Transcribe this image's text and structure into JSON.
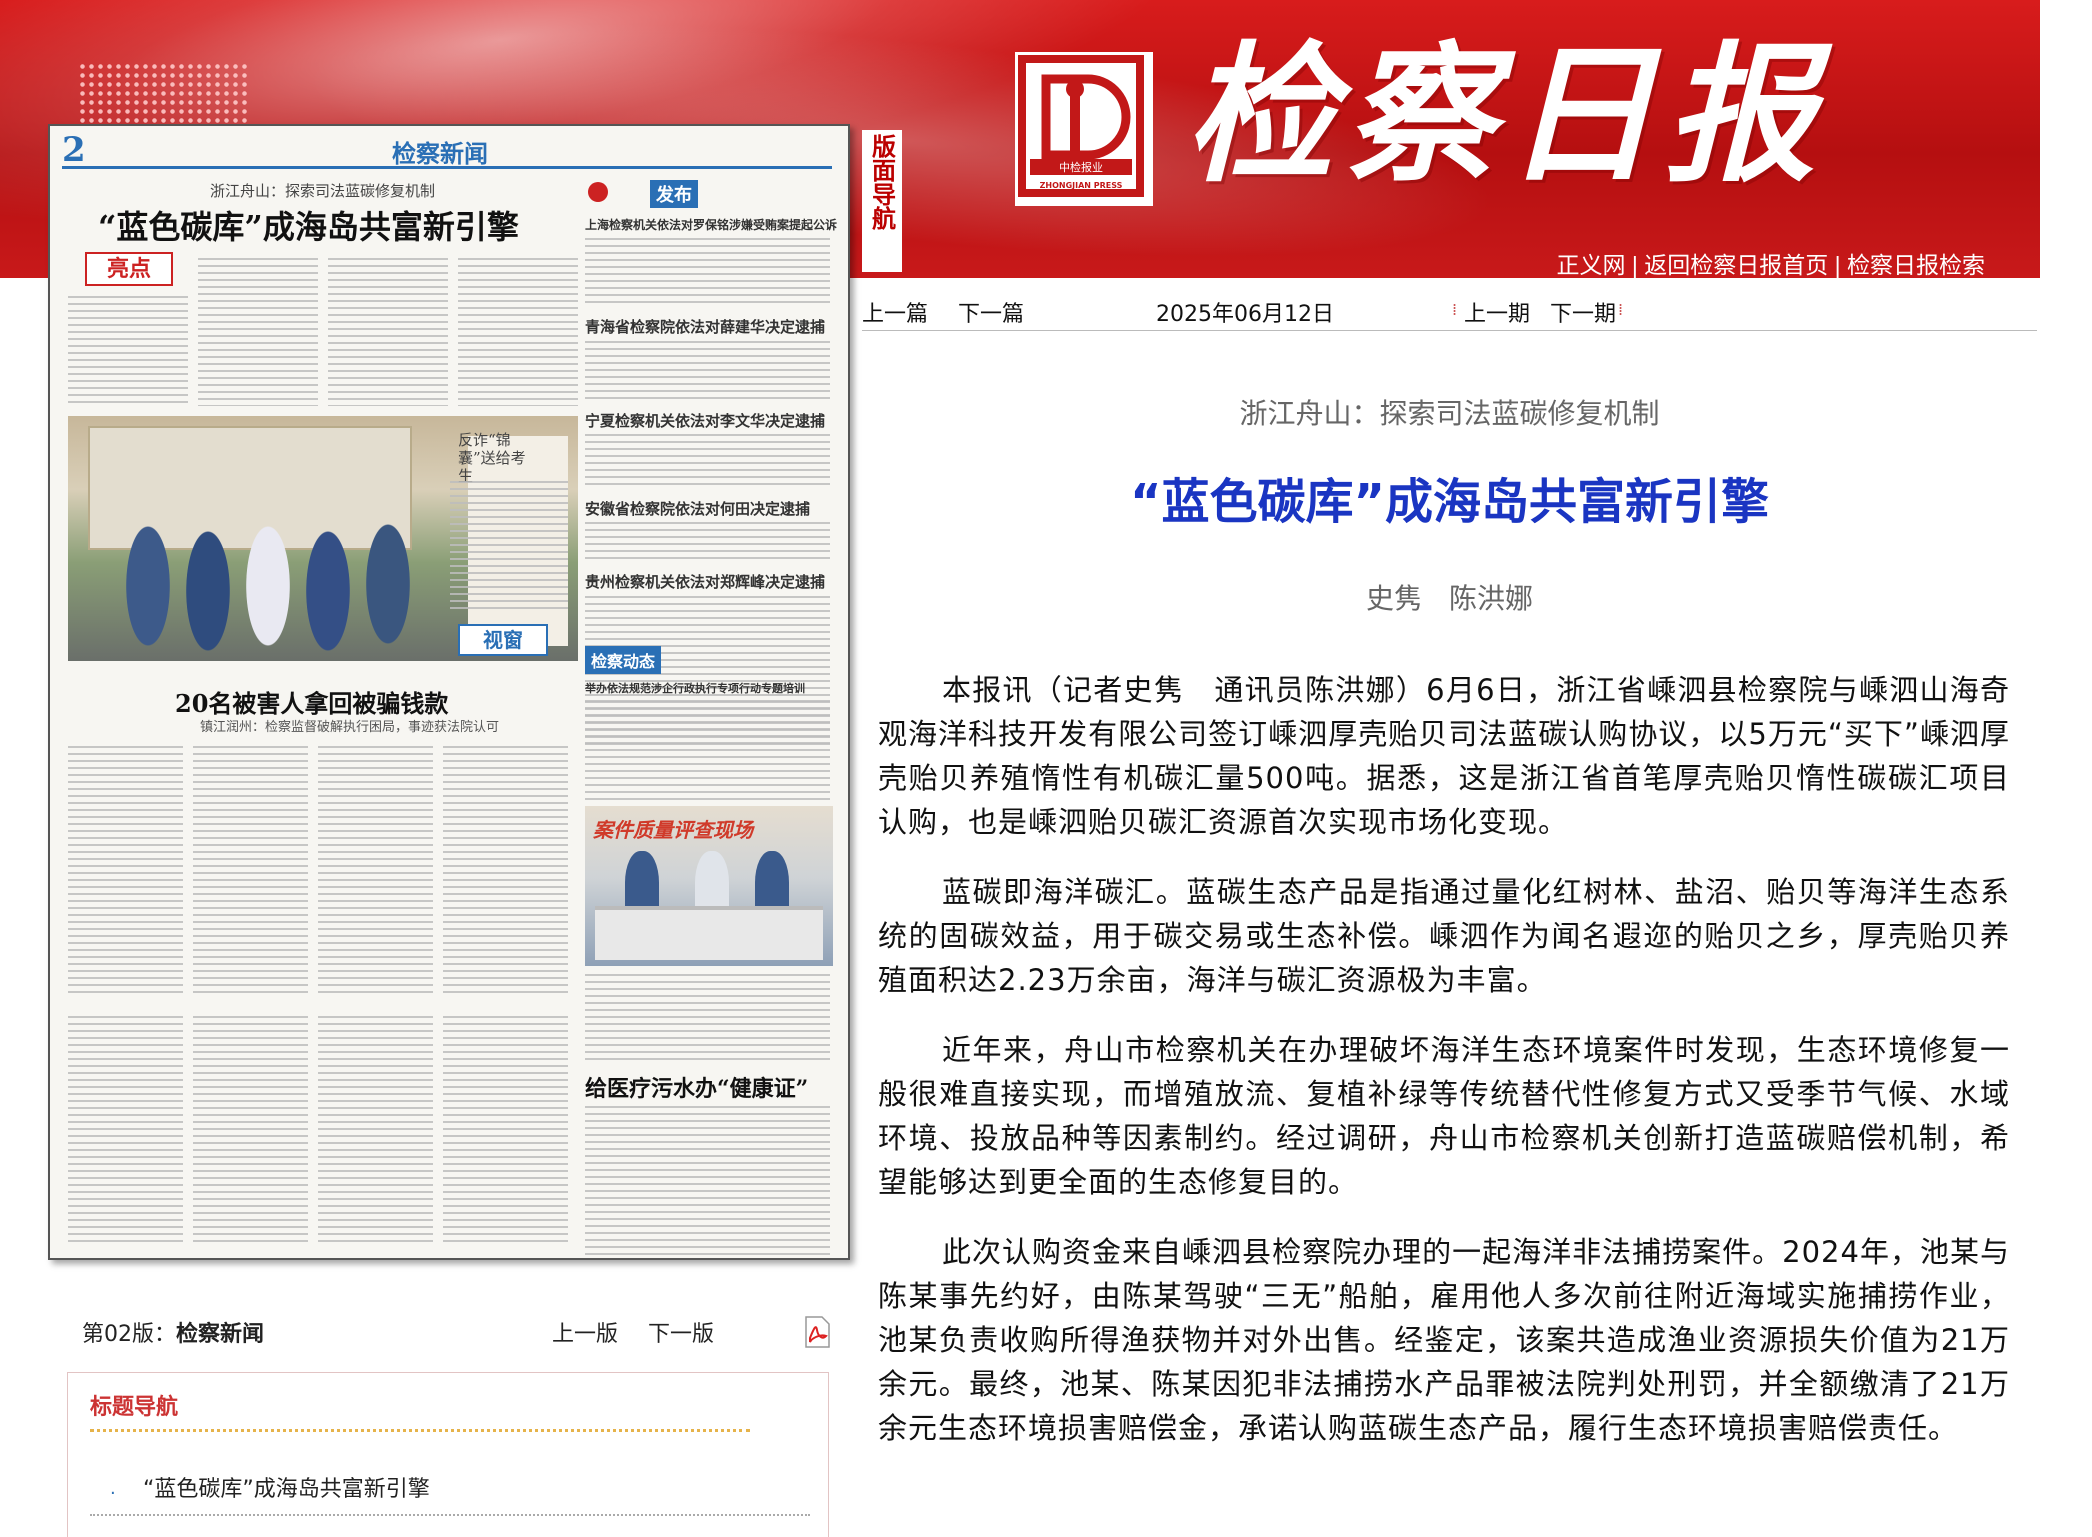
{
  "header": {
    "masthead": "检察日报",
    "logo_text": "中检报业",
    "logo_en": "ZHONGJIAN PRESS",
    "nav_vertical": "版面导航",
    "links": [
      "正义网",
      "返回检察日报首页",
      "检察日报检索"
    ],
    "separator": "|"
  },
  "newspaper_thumb": {
    "page_number": "2",
    "section": "检察新闻",
    "sub_headline": "浙江舟山：探索司法蓝碳修复机制",
    "main_headline": "“蓝色碳库”成海岛共富新引擎",
    "liangdian": "亮点",
    "photo_caption": "反诈“锦囊”送给考生",
    "shichuang": "视窗",
    "headline2": "20名被害人拿回被骗钱款",
    "headline2_sub": "镇江润州：检察监督破解执行困局，事迹获法院认可",
    "fabu": "发布",
    "right_headlines": [
      "上海检察机关依法对罗保铭涉嫌受贿案提起公诉",
      "青海省检察院依法对薛建华决定逮捕",
      "宁夏检察机关依法对李文华决定逮捕",
      "安徽省检察院依法对何田决定逮捕",
      "贵州检察机关依法对郑辉峰决定逮捕"
    ],
    "dongtai": "检察动态",
    "dongtai_headline": "举办依法规范涉企行政执行专项行动专题培训",
    "photo2_title": "案件质量评查现场",
    "headline3": "给医疗污水办“健康证”"
  },
  "page_info": {
    "label": "第02版：",
    "section": "检察新闻",
    "prev": "上一版",
    "next": "下一版"
  },
  "title_nav": {
    "label": "标题导航",
    "items": [
      "“蓝色碳库”成海岛共富新引擎"
    ]
  },
  "article_nav": {
    "prev_article": "上一篇",
    "next_article": "下一篇",
    "date": "2025年06月12日",
    "prev_issue": "上一期",
    "next_issue": "下一期"
  },
  "article": {
    "subtitle": "浙江舟山：探索司法蓝碳修复机制",
    "title": "“蓝色碳库”成海岛共富新引擎",
    "authors": "史隽 陈洪娜",
    "paragraphs": [
      "本报讯（记者史隽　通讯员陈洪娜）6月6日，浙江省嵊泗县检察院与嵊泗山海奇观海洋科技开发有限公司签订嵊泗厚壳贻贝司法蓝碳认购协议，以5万元“买下”嵊泗厚壳贻贝养殖惰性有机碳汇量500吨。据悉，这是浙江省首笔厚壳贻贝惰性碳碳汇项目认购，也是嵊泗贻贝碳汇资源首次实现市场化变现。",
      "蓝碳即海洋碳汇。蓝碳生态产品是指通过量化红树林、盐沼、贻贝等海洋生态系统的固碳效益，用于碳交易或生态补偿。嵊泗作为闻名遐迩的贻贝之乡，厚壳贻贝养殖面积达2.23万余亩，海洋与碳汇资源极为丰富。",
      "近年来，舟山市检察机关在办理破坏海洋生态环境案件时发现，生态环境修复一般很难直接实现，而增殖放流、复植补绿等传统替代性修复方式又受季节气候、水域环境、投放品种等因素制约。经过调研，舟山市检察机关创新打造蓝碳赔偿机制，希望能够达到更全面的生态修复目的。",
      "此次认购资金来自嵊泗县检察院办理的一起海洋非法捕捞案件。2024年，池某与陈某事先约好，由陈某驾驶“三无”船舶，雇用他人多次前往附近海域实施捕捞作业，池某负责收购所得渔获物并对外出售。经鉴定，该案共造成渔业资源损失价值为21万余元。最终，池某、陈某因犯非法捕捞水产品罪被法院判处刑罚，并全额缴清了21万余元生态环境损害赔偿金，承诺认购蓝碳生态产品，履行生态环境损害赔偿责任。"
    ]
  }
}
